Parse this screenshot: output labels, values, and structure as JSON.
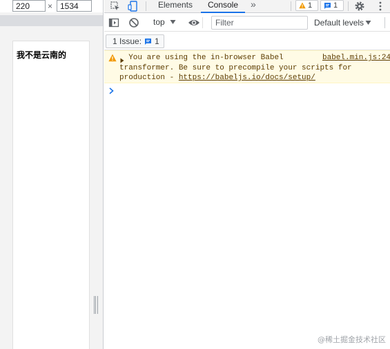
{
  "device_toolbar": {
    "width_value": "220",
    "dimension_separator": "×",
    "height_value": "1534"
  },
  "page": {
    "heading": "我不是云南的"
  },
  "devtools": {
    "tabs": [
      {
        "label": "Elements",
        "active": false
      },
      {
        "label": "Console",
        "active": true
      }
    ],
    "more_tabs_icon": "double-chevron-right-icon",
    "warnings_count": "1",
    "issues_count": "1",
    "accent_color": "#1a73e8"
  },
  "console_toolbar": {
    "context": "top",
    "filter_placeholder": "Filter",
    "levels": "Default levels"
  },
  "issues_bar": {
    "label": "1 Issue:",
    "count": "1"
  },
  "console": {
    "messages": [
      {
        "level": "warning",
        "text_line1": "You are using the in-browser Babel",
        "text_line2": "transformer. Be sure to precompile your scripts for",
        "text_line3": "production - ",
        "link_text": "https://babeljs.io/docs/setup/",
        "source": "babel.min.js:24",
        "background": "#fffbe5",
        "text_color": "#5c3c00"
      }
    ],
    "prompt_symbol": "›"
  },
  "watermark": "@稀土掘金技术社区"
}
